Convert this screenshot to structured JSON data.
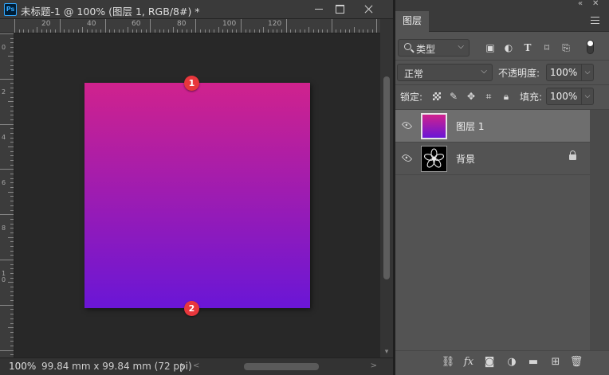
{
  "document": {
    "app_icon": "Ps",
    "title": "未标题-1 @ 100% (图层 1, RGB/8#) *",
    "window_controls": [
      "minimize-icon",
      "maximize-icon",
      "close-icon"
    ],
    "ruler_h_labels": [
      "20",
      "40",
      "60",
      "80",
      "100",
      "120"
    ],
    "ruler_v_labels": [
      "0",
      "2",
      "4",
      "6",
      "8",
      "10"
    ],
    "canvas": {
      "gradient_top": "#d0228d",
      "gradient_bottom": "#6a16d6",
      "markers": [
        "1",
        "2"
      ]
    },
    "status": {
      "zoom": "100%",
      "info": "99.84 mm x 99.84 mm (72 ppi)",
      "info_arrow": "〉"
    }
  },
  "panel": {
    "tab": "图层",
    "filter": {
      "label": "类型",
      "icons": [
        "image-filter-icon",
        "adjustment-filter-icon",
        "type-filter-icon",
        "shape-filter-icon",
        "smart-object-filter-icon"
      ]
    },
    "blend_mode": "正常",
    "opacity_label": "不透明度:",
    "opacity_value": "100%",
    "lock_label": "锁定:",
    "lock_icons": [
      "lock-transparent-icon",
      "lock-image-icon",
      "lock-position-icon",
      "lock-artboard-icon",
      "lock-all-icon"
    ],
    "fill_label": "填充:",
    "fill_value": "100%",
    "layers": [
      {
        "name": "图层 1",
        "selected": true,
        "thumbnail": "gradient"
      },
      {
        "name": "背景",
        "selected": false,
        "thumbnail": "flower",
        "locked": true
      }
    ],
    "bottom_icons": [
      "link-icon",
      "fx-icon",
      "mask-icon",
      "adjustment-layer-icon",
      "folder-icon",
      "new-layer-icon",
      "trash-icon"
    ]
  }
}
